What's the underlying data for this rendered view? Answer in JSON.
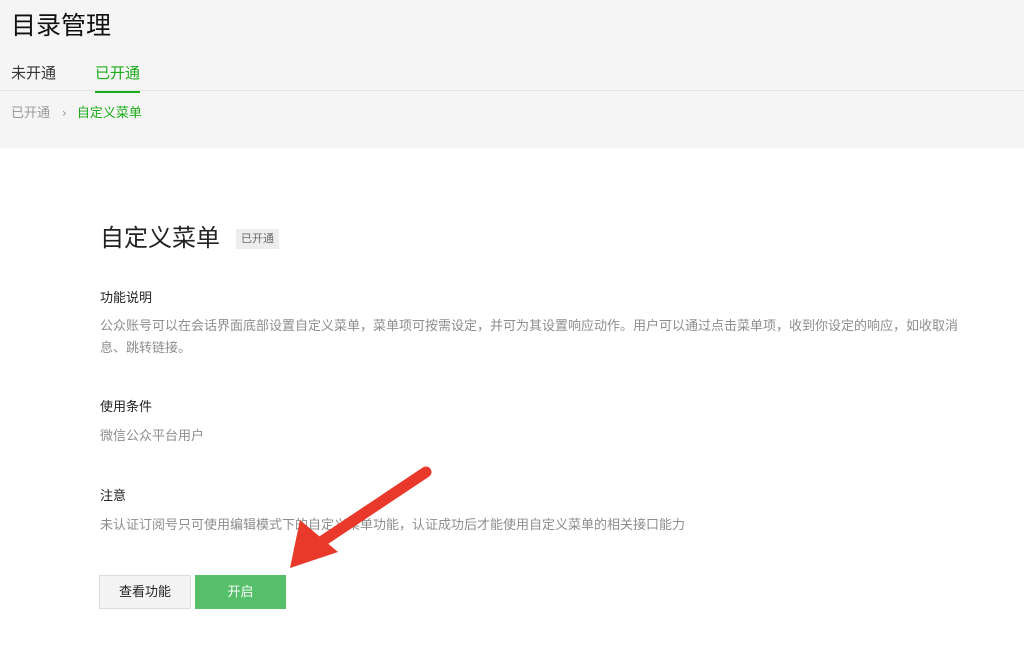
{
  "header": {
    "title": "目录管理"
  },
  "tabs": [
    {
      "label": "未开通"
    },
    {
      "label": "已开通",
      "active": true
    }
  ],
  "breadcrumb": {
    "parent": "已开通",
    "separator": "›",
    "current": "自定义菜单"
  },
  "feature": {
    "title": "自定义菜单",
    "status_badge": "已开通",
    "sections": [
      {
        "label": "功能说明",
        "text": "公众账号可以在会话界面底部设置自定义菜单，菜单项可按需设定，并可为其设置响应动作。用户可以通过点击菜单项，收到你设定的响应，如收取消息、跳转链接。"
      },
      {
        "label": "使用条件",
        "text": "微信公众平台用户"
      },
      {
        "label": "注意",
        "text": "未认证订阅号只可使用编辑模式下的自定义菜单功能，认证成功后才能使用自定义菜单的相关接口能力"
      }
    ],
    "buttons": {
      "view": "查看功能",
      "open": "开启"
    }
  },
  "colors": {
    "accent": "#1aad19",
    "primary_button": "#56bf6a",
    "annotation_arrow": "#e8392b"
  },
  "annotation": {
    "icon": "red-arrow-icon"
  }
}
